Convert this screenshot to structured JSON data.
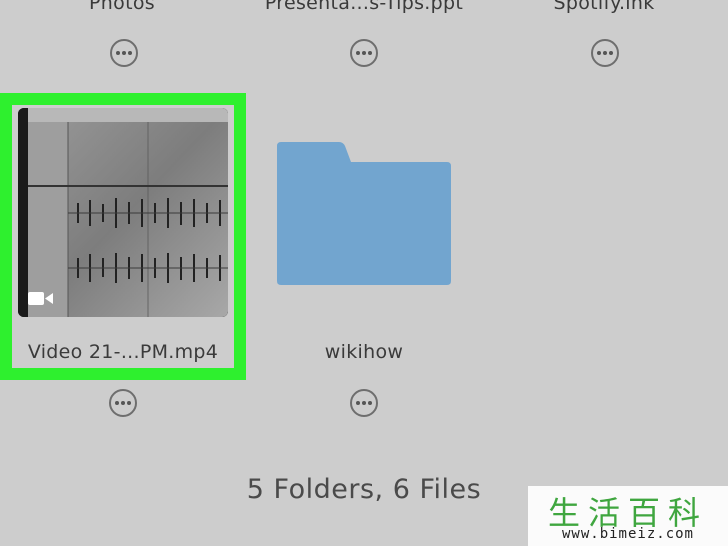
{
  "top_row": [
    {
      "label": "Photos"
    },
    {
      "label": "Presenta...s-Tips.ppt"
    },
    {
      "label": "Spotify.lnk"
    }
  ],
  "items": [
    {
      "label": "Video 21-...PM.mp4",
      "kind": "video",
      "selected": true
    },
    {
      "label": "wikihow",
      "kind": "folder"
    }
  ],
  "footer": {
    "summary": "5 Folders, 6 Files"
  },
  "watermark": {
    "text": "生活百科",
    "url": "www.bimeiz.com"
  },
  "colors": {
    "selection": "#2ef02e",
    "folder": "#72a5cf",
    "background": "#cdcdcd"
  },
  "icons": {
    "more": "ellipsis-circle-icon",
    "video": "video-camera-icon",
    "folder": "folder-icon"
  }
}
